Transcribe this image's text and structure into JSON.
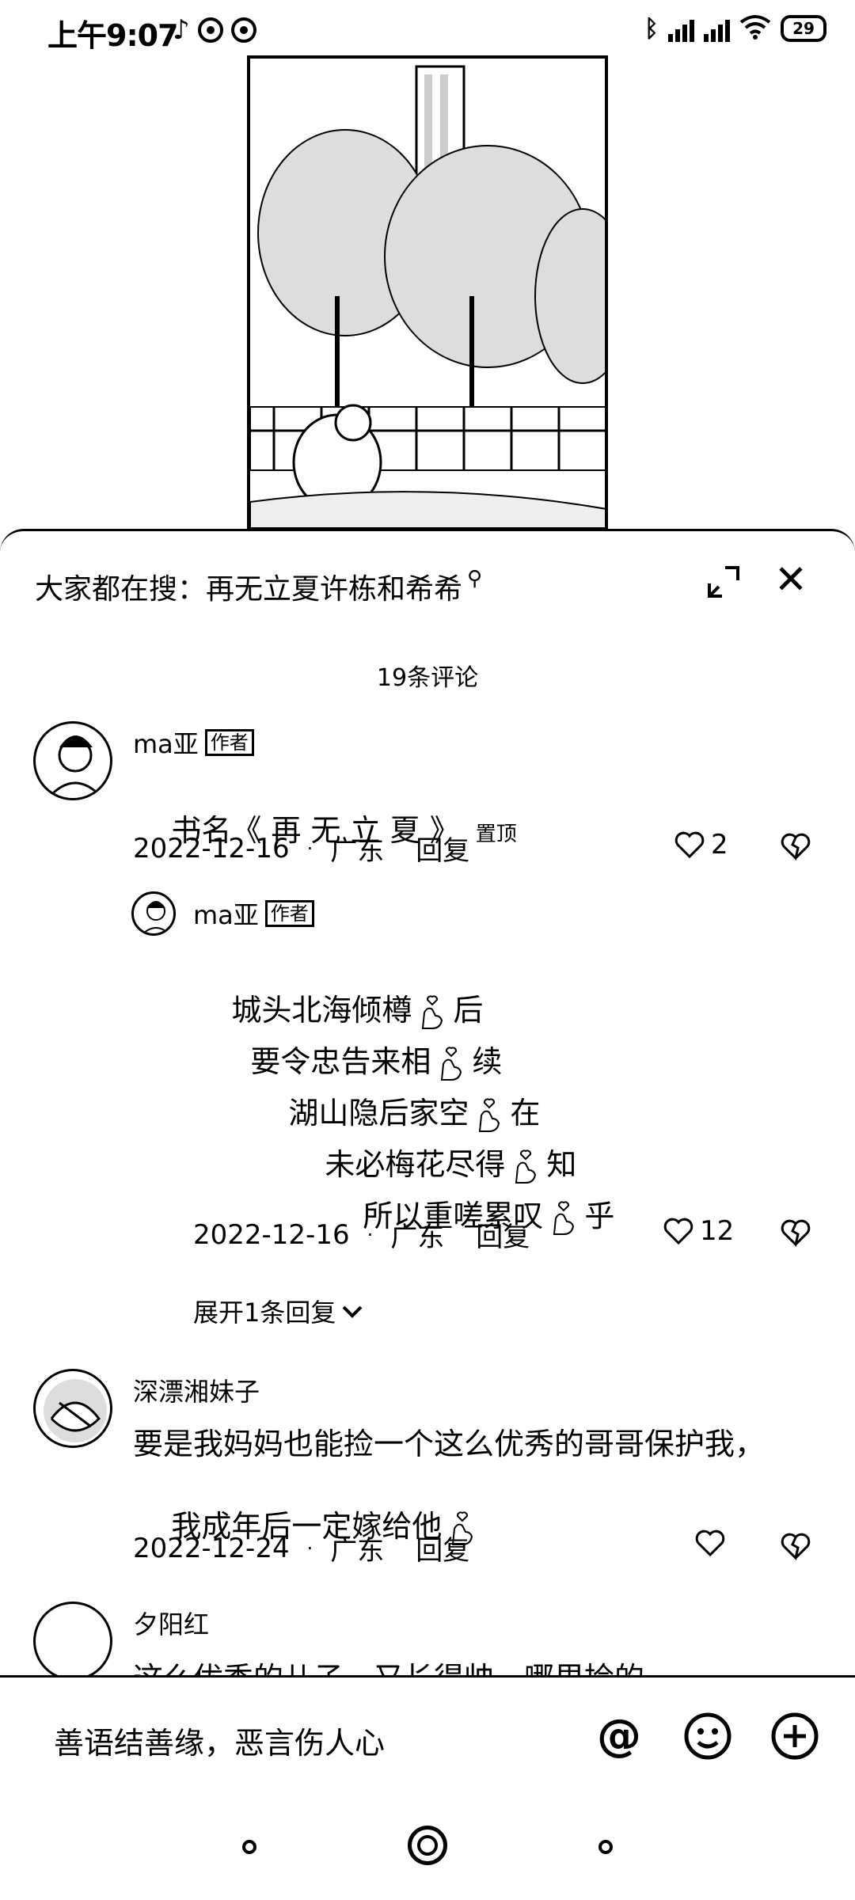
{
  "status_bar": {
    "time": "上午9:07",
    "battery": "29"
  },
  "sheet": {
    "search_prefix": "大家都在搜：",
    "search_query": "再无立夏许栋和希希",
    "comment_count": "19条评论"
  },
  "comments": [
    {
      "user": "ma亚",
      "tag": "作者",
      "text": "书名《 再 无 立 夏 》",
      "pinned_label": "置顶",
      "date": "2022-12-16",
      "location": "广东",
      "reply_label": "回复",
      "likes": "2"
    },
    {
      "user": "ma亚",
      "tag": "作者",
      "lines": [
        {
          "before": "城头北海倾樽",
          "after": "后"
        },
        {
          "before": "要令忠告来相",
          "after": "续"
        },
        {
          "before": "湖山隐后家空",
          "after": "在"
        },
        {
          "before": "未必梅花尽得",
          "after": "知"
        },
        {
          "before": "所以重嗟累叹",
          "after": "乎"
        }
      ],
      "date": "2022-12-16",
      "location": "广东",
      "reply_label": "回复",
      "likes": "12"
    },
    {
      "user": "深漂湘妹子",
      "line1": "要是我妈妈也能捡一个这么优秀的哥哥保护我，",
      "line2": "我成年后一定嫁给他",
      "date": "2022-12-24",
      "location": "广东",
      "reply_label": "回复"
    },
    {
      "user": "夕阳红",
      "text": "这么优秀的儿子，又长得帅，哪里捡的"
    }
  ],
  "expand_replies": "展开1条回复",
  "input": {
    "placeholder": "善语结善缘，恶言伤人心"
  },
  "icons": {
    "mention": "at-icon",
    "emoji": "smile-icon",
    "add": "plus-icon"
  }
}
